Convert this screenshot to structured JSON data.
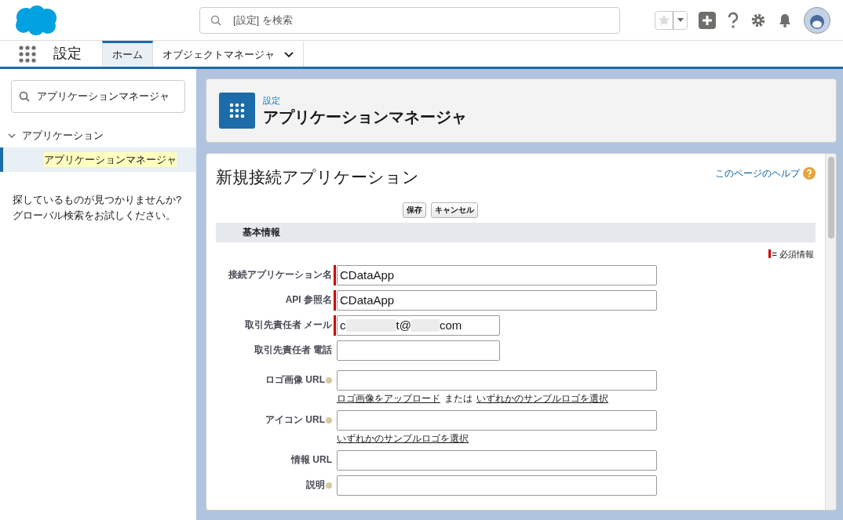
{
  "header": {
    "search_placeholder": "[設定] を検索"
  },
  "nav": {
    "app_name": "設定",
    "tabs": [
      {
        "label": "ホーム",
        "selected": true,
        "menu": false
      },
      {
        "label": "オブジェクトマネージャ",
        "selected": false,
        "menu": true
      }
    ]
  },
  "sidebar": {
    "search_value": "アプリケーションマネージャ",
    "tree": [
      {
        "label": "アプリケーション",
        "expanded": true,
        "children": [
          {
            "label": "アプリケーションマネージャ",
            "selected": true
          }
        ]
      }
    ],
    "help_text": "探しているものが見つかりませんか?\nグローバル検索をお試しください。"
  },
  "page_header": {
    "breadcrumb": "設定",
    "title": "アプリケーションマネージャ"
  },
  "form": {
    "title": "新規接続アプリケーション",
    "help_link": "このページのヘルプ",
    "buttons": [
      "保存",
      "キャンセル"
    ],
    "section": "基本情報",
    "required_legend": "= 必須情報",
    "fields": [
      {
        "label": "接続アプリケーション名",
        "required": true,
        "help": false,
        "wide": true,
        "value": "CDataApp"
      },
      {
        "label": "API 参照名",
        "required": true,
        "help": false,
        "wide": true,
        "value": "CDataApp"
      },
      {
        "label": "取引先責任者 メール",
        "required": true,
        "help": false,
        "wide": false,
        "value_parts": [
          "c",
          "t@",
          "com"
        ]
      },
      {
        "label": "取引先責任者 電話",
        "required": false,
        "help": false,
        "wide": false
      },
      {
        "label": "ロゴ画像 URL",
        "required": false,
        "help": true,
        "wide": true,
        "links": [
          "ロゴ画像をアップロード",
          "いずれかのサンプルロゴを選択"
        ],
        "link_joiner": "または"
      },
      {
        "label": "アイコン URL",
        "required": false,
        "help": true,
        "wide": true,
        "links": [
          "いずれかのサンプルロゴを選択"
        ]
      },
      {
        "label": "情報 URL",
        "required": false,
        "help": false,
        "wide": true
      },
      {
        "label": "説明",
        "required": false,
        "help": true,
        "wide": true
      }
    ]
  }
}
